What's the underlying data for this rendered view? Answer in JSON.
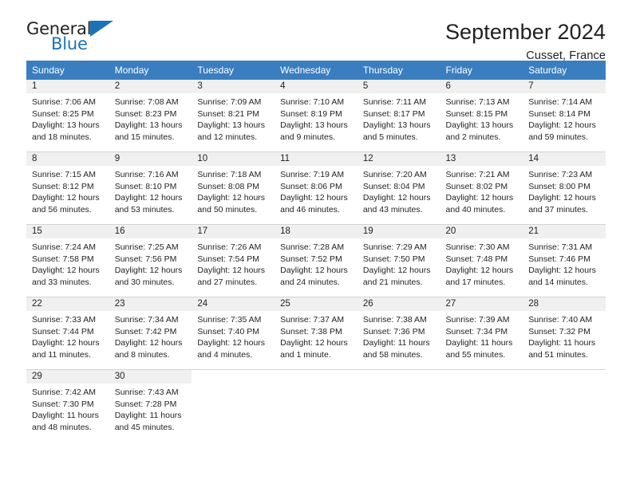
{
  "branding": {
    "name_part1": "General",
    "name_part2": "Blue",
    "accent_color": "#1b72b8"
  },
  "header": {
    "month_title": "September 2024",
    "location": "Cusset, France"
  },
  "calendar": {
    "header_bg": "#3a7ec0",
    "daynum_bg": "#f0f0f0",
    "weekday_names": [
      "Sunday",
      "Monday",
      "Tuesday",
      "Wednesday",
      "Thursday",
      "Friday",
      "Saturday"
    ],
    "weeks": [
      [
        {
          "day": "1",
          "sunrise": "Sunrise: 7:06 AM",
          "sunset": "Sunset: 8:25 PM",
          "daylight1": "Daylight: 13 hours",
          "daylight2": "and 18 minutes."
        },
        {
          "day": "2",
          "sunrise": "Sunrise: 7:08 AM",
          "sunset": "Sunset: 8:23 PM",
          "daylight1": "Daylight: 13 hours",
          "daylight2": "and 15 minutes."
        },
        {
          "day": "3",
          "sunrise": "Sunrise: 7:09 AM",
          "sunset": "Sunset: 8:21 PM",
          "daylight1": "Daylight: 13 hours",
          "daylight2": "and 12 minutes."
        },
        {
          "day": "4",
          "sunrise": "Sunrise: 7:10 AM",
          "sunset": "Sunset: 8:19 PM",
          "daylight1": "Daylight: 13 hours",
          "daylight2": "and 9 minutes."
        },
        {
          "day": "5",
          "sunrise": "Sunrise: 7:11 AM",
          "sunset": "Sunset: 8:17 PM",
          "daylight1": "Daylight: 13 hours",
          "daylight2": "and 5 minutes."
        },
        {
          "day": "6",
          "sunrise": "Sunrise: 7:13 AM",
          "sunset": "Sunset: 8:15 PM",
          "daylight1": "Daylight: 13 hours",
          "daylight2": "and 2 minutes."
        },
        {
          "day": "7",
          "sunrise": "Sunrise: 7:14 AM",
          "sunset": "Sunset: 8:14 PM",
          "daylight1": "Daylight: 12 hours",
          "daylight2": "and 59 minutes."
        }
      ],
      [
        {
          "day": "8",
          "sunrise": "Sunrise: 7:15 AM",
          "sunset": "Sunset: 8:12 PM",
          "daylight1": "Daylight: 12 hours",
          "daylight2": "and 56 minutes."
        },
        {
          "day": "9",
          "sunrise": "Sunrise: 7:16 AM",
          "sunset": "Sunset: 8:10 PM",
          "daylight1": "Daylight: 12 hours",
          "daylight2": "and 53 minutes."
        },
        {
          "day": "10",
          "sunrise": "Sunrise: 7:18 AM",
          "sunset": "Sunset: 8:08 PM",
          "daylight1": "Daylight: 12 hours",
          "daylight2": "and 50 minutes."
        },
        {
          "day": "11",
          "sunrise": "Sunrise: 7:19 AM",
          "sunset": "Sunset: 8:06 PM",
          "daylight1": "Daylight: 12 hours",
          "daylight2": "and 46 minutes."
        },
        {
          "day": "12",
          "sunrise": "Sunrise: 7:20 AM",
          "sunset": "Sunset: 8:04 PM",
          "daylight1": "Daylight: 12 hours",
          "daylight2": "and 43 minutes."
        },
        {
          "day": "13",
          "sunrise": "Sunrise: 7:21 AM",
          "sunset": "Sunset: 8:02 PM",
          "daylight1": "Daylight: 12 hours",
          "daylight2": "and 40 minutes."
        },
        {
          "day": "14",
          "sunrise": "Sunrise: 7:23 AM",
          "sunset": "Sunset: 8:00 PM",
          "daylight1": "Daylight: 12 hours",
          "daylight2": "and 37 minutes."
        }
      ],
      [
        {
          "day": "15",
          "sunrise": "Sunrise: 7:24 AM",
          "sunset": "Sunset: 7:58 PM",
          "daylight1": "Daylight: 12 hours",
          "daylight2": "and 33 minutes."
        },
        {
          "day": "16",
          "sunrise": "Sunrise: 7:25 AM",
          "sunset": "Sunset: 7:56 PM",
          "daylight1": "Daylight: 12 hours",
          "daylight2": "and 30 minutes."
        },
        {
          "day": "17",
          "sunrise": "Sunrise: 7:26 AM",
          "sunset": "Sunset: 7:54 PM",
          "daylight1": "Daylight: 12 hours",
          "daylight2": "and 27 minutes."
        },
        {
          "day": "18",
          "sunrise": "Sunrise: 7:28 AM",
          "sunset": "Sunset: 7:52 PM",
          "daylight1": "Daylight: 12 hours",
          "daylight2": "and 24 minutes."
        },
        {
          "day": "19",
          "sunrise": "Sunrise: 7:29 AM",
          "sunset": "Sunset: 7:50 PM",
          "daylight1": "Daylight: 12 hours",
          "daylight2": "and 21 minutes."
        },
        {
          "day": "20",
          "sunrise": "Sunrise: 7:30 AM",
          "sunset": "Sunset: 7:48 PM",
          "daylight1": "Daylight: 12 hours",
          "daylight2": "and 17 minutes."
        },
        {
          "day": "21",
          "sunrise": "Sunrise: 7:31 AM",
          "sunset": "Sunset: 7:46 PM",
          "daylight1": "Daylight: 12 hours",
          "daylight2": "and 14 minutes."
        }
      ],
      [
        {
          "day": "22",
          "sunrise": "Sunrise: 7:33 AM",
          "sunset": "Sunset: 7:44 PM",
          "daylight1": "Daylight: 12 hours",
          "daylight2": "and 11 minutes."
        },
        {
          "day": "23",
          "sunrise": "Sunrise: 7:34 AM",
          "sunset": "Sunset: 7:42 PM",
          "daylight1": "Daylight: 12 hours",
          "daylight2": "and 8 minutes."
        },
        {
          "day": "24",
          "sunrise": "Sunrise: 7:35 AM",
          "sunset": "Sunset: 7:40 PM",
          "daylight1": "Daylight: 12 hours",
          "daylight2": "and 4 minutes."
        },
        {
          "day": "25",
          "sunrise": "Sunrise: 7:37 AM",
          "sunset": "Sunset: 7:38 PM",
          "daylight1": "Daylight: 12 hours",
          "daylight2": "and 1 minute."
        },
        {
          "day": "26",
          "sunrise": "Sunrise: 7:38 AM",
          "sunset": "Sunset: 7:36 PM",
          "daylight1": "Daylight: 11 hours",
          "daylight2": "and 58 minutes."
        },
        {
          "day": "27",
          "sunrise": "Sunrise: 7:39 AM",
          "sunset": "Sunset: 7:34 PM",
          "daylight1": "Daylight: 11 hours",
          "daylight2": "and 55 minutes."
        },
        {
          "day": "28",
          "sunrise": "Sunrise: 7:40 AM",
          "sunset": "Sunset: 7:32 PM",
          "daylight1": "Daylight: 11 hours",
          "daylight2": "and 51 minutes."
        }
      ],
      [
        {
          "day": "29",
          "sunrise": "Sunrise: 7:42 AM",
          "sunset": "Sunset: 7:30 PM",
          "daylight1": "Daylight: 11 hours",
          "daylight2": "and 48 minutes."
        },
        {
          "day": "30",
          "sunrise": "Sunrise: 7:43 AM",
          "sunset": "Sunset: 7:28 PM",
          "daylight1": "Daylight: 11 hours",
          "daylight2": "and 45 minutes."
        },
        {
          "day": "",
          "sunrise": "",
          "sunset": "",
          "daylight1": "",
          "daylight2": ""
        },
        {
          "day": "",
          "sunrise": "",
          "sunset": "",
          "daylight1": "",
          "daylight2": ""
        },
        {
          "day": "",
          "sunrise": "",
          "sunset": "",
          "daylight1": "",
          "daylight2": ""
        },
        {
          "day": "",
          "sunrise": "",
          "sunset": "",
          "daylight1": "",
          "daylight2": ""
        },
        {
          "day": "",
          "sunrise": "",
          "sunset": "",
          "daylight1": "",
          "daylight2": ""
        }
      ]
    ]
  }
}
